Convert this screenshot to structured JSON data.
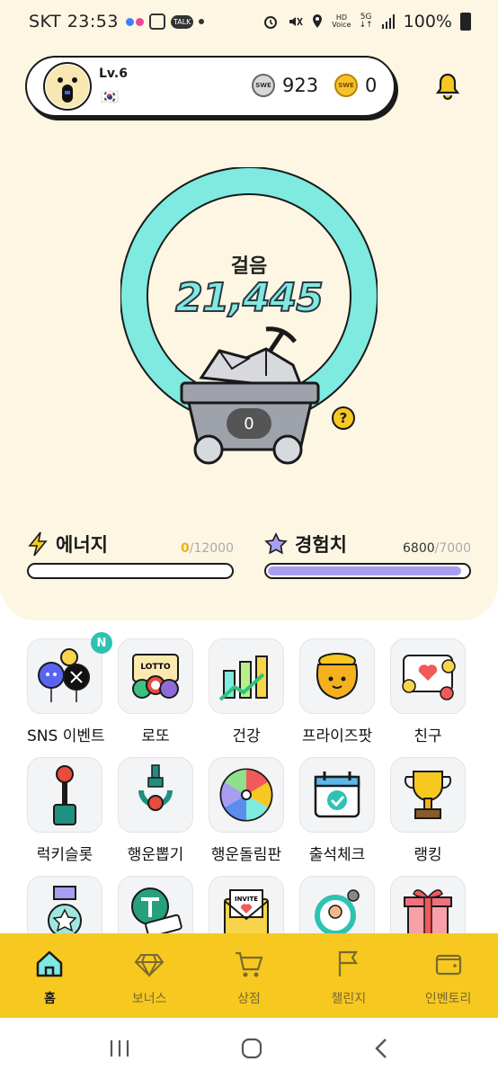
{
  "status_bar": {
    "time": "SKT 23:53",
    "battery": "100%",
    "right_icons": [
      "alarm-icon",
      "mute-icon",
      "location-icon",
      "hd-voice-icon",
      "5g-icon",
      "signal-icon",
      "battery-icon"
    ]
  },
  "profile": {
    "level": "Lv.6",
    "flag": "🇰🇷",
    "coin_a_label": "SWE",
    "coin_a_value": "923",
    "coin_b_label": "SWE",
    "coin_b_value": "0"
  },
  "steps": {
    "label": "걸음",
    "value": "21,445",
    "cart_count": "0",
    "help": "?"
  },
  "energy": {
    "label": "에너지",
    "current": "0",
    "max": "/12000",
    "fraction": 0.0
  },
  "experience": {
    "label": "경험치",
    "current": "6800",
    "max": "/7000",
    "fraction": 0.971
  },
  "menu": [
    {
      "label": "SNS 이벤트",
      "icon": "sns-event-icon",
      "badge": "N"
    },
    {
      "label": "로또",
      "icon": "lotto-icon"
    },
    {
      "label": "건강",
      "icon": "health-chart-icon"
    },
    {
      "label": "프라이즈팟",
      "icon": "prize-pot-icon"
    },
    {
      "label": "친구",
      "icon": "friends-icon"
    },
    {
      "label": "럭키슬롯",
      "icon": "lucky-slot-icon"
    },
    {
      "label": "행운뽑기",
      "icon": "claw-machine-icon"
    },
    {
      "label": "행운돌림판",
      "icon": "roulette-wheel-icon"
    },
    {
      "label": "출석체크",
      "icon": "calendar-check-icon"
    },
    {
      "label": "랭킹",
      "icon": "trophy-icon"
    },
    {
      "label": "",
      "icon": "medal-icon"
    },
    {
      "label": "",
      "icon": "tether-signup-icon"
    },
    {
      "label": "",
      "icon": "invite-envelope-icon"
    },
    {
      "label": "",
      "icon": "profile-settings-icon"
    },
    {
      "label": "",
      "icon": "gift-box-icon"
    }
  ],
  "bottom_nav": [
    {
      "label": "홈",
      "icon": "home-icon",
      "active": true
    },
    {
      "label": "보너스",
      "icon": "diamond-icon"
    },
    {
      "label": "상점",
      "icon": "cart-icon"
    },
    {
      "label": "챌린지",
      "icon": "flag-icon"
    },
    {
      "label": "인벤토리",
      "icon": "wallet-icon"
    }
  ],
  "colors": {
    "accent": "#f7c81f",
    "ring": "#7eeae0",
    "exp_bar": "#a79ef0",
    "badge": "#2ec2b3"
  }
}
